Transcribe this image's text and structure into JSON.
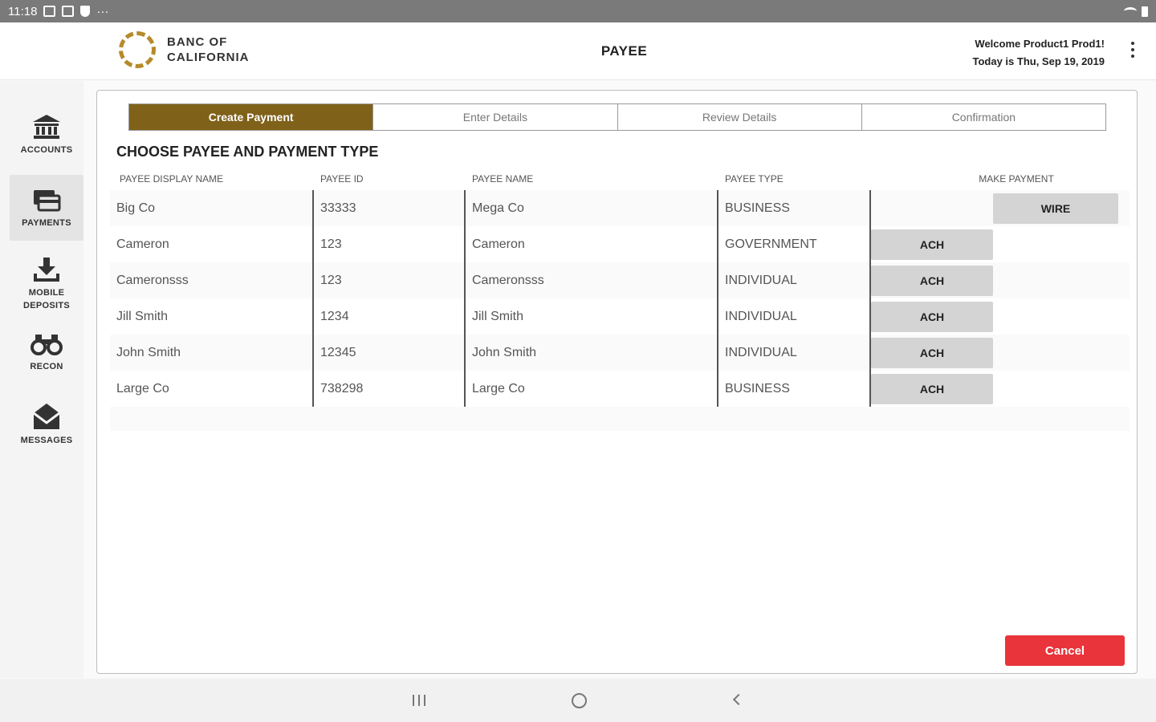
{
  "status_bar": {
    "time": "11:18",
    "more": "···"
  },
  "brand": {
    "line1": "BANC OF",
    "line2": "CALIFORNIA"
  },
  "header": {
    "title": "PAYEE",
    "welcome": "Welcome Product1 Prod1!",
    "date_text": "Today is Thu, Sep 19, 2019"
  },
  "nav": {
    "items": [
      {
        "label": "ACCOUNTS",
        "icon": "bank-icon"
      },
      {
        "label": "PAYMENTS",
        "icon": "payments-icon",
        "active": true
      },
      {
        "label_line1": "MOBILE",
        "label_line2": "DEPOSITS",
        "icon": "download-tray-icon"
      },
      {
        "label": "RECON",
        "icon": "binoculars-icon"
      },
      {
        "label": "MESSAGES",
        "icon": "envelope-icon"
      }
    ]
  },
  "steps": [
    {
      "label": "Create Payment",
      "active": true
    },
    {
      "label": "Enter Details"
    },
    {
      "label": "Review Details"
    },
    {
      "label": "Confirmation"
    }
  ],
  "section_title": "CHOOSE PAYEE AND PAYMENT TYPE",
  "table": {
    "headers": [
      "PAYEE DISPLAY NAME",
      "PAYEE ID",
      "PAYEE NAME",
      "PAYEE TYPE",
      "MAKE PAYMENT"
    ],
    "rows": [
      {
        "display_name": "Big Co",
        "payee_id": "33333",
        "payee_name": "Mega Co",
        "payee_type": "BUSINESS",
        "action": "WIRE"
      },
      {
        "display_name": "Cameron",
        "payee_id": "123",
        "payee_name": "Cameron",
        "payee_type": "GOVERNMENT",
        "action": "ACH"
      },
      {
        "display_name": "Cameronsss",
        "payee_id": "123",
        "payee_name": "Cameronsss",
        "payee_type": "INDIVIDUAL",
        "action": "ACH"
      },
      {
        "display_name": "Jill Smith",
        "payee_id": "1234",
        "payee_name": "Jill Smith",
        "payee_type": "INDIVIDUAL",
        "action": "ACH"
      },
      {
        "display_name": "John Smith",
        "payee_id": "12345",
        "payee_name": "John Smith",
        "payee_type": "INDIVIDUAL",
        "action": "ACH"
      },
      {
        "display_name": "Large Co",
        "payee_id": "738298",
        "payee_name": "Large Co",
        "payee_type": "BUSINESS",
        "action": "ACH"
      }
    ]
  },
  "cancel_label": "Cancel",
  "colors": {
    "brand_gold": "#7f6119",
    "logo_gold": "#b58b2a",
    "cancel_red": "#e8343a"
  }
}
